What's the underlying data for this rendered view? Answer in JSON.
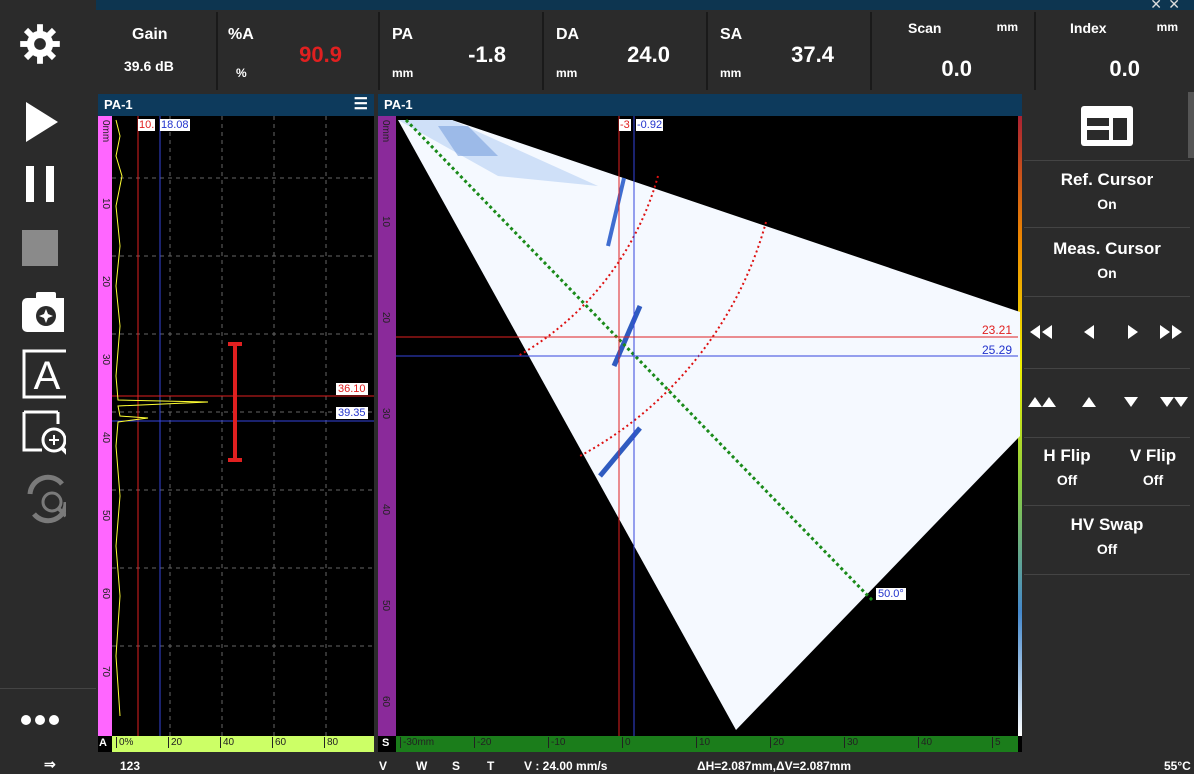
{
  "toolbar": {
    "icons": [
      "gear-icon",
      "play-icon",
      "pause-icon",
      "stop-icon",
      "camera-icon",
      "text-annotation-icon",
      "zoom-icon",
      "refresh-zoom-icon",
      "more-icon"
    ]
  },
  "readouts": {
    "gain": {
      "label": "Gain",
      "value": "39.6 dB"
    },
    "pa_a": {
      "label": "%A",
      "unit": "%",
      "value": "90.9",
      "color": "#e02020"
    },
    "pa": {
      "label": "PA",
      "unit": "mm",
      "value": "-1.8"
    },
    "da": {
      "label": "DA",
      "unit": "mm",
      "value": "24.0"
    },
    "sa": {
      "label": "SA",
      "unit": "mm",
      "value": "37.4"
    },
    "scan": {
      "label": "Scan",
      "unit": "mm",
      "value": "0.0"
    },
    "index": {
      "label": "Index",
      "unit": "mm",
      "value": "0.0"
    }
  },
  "ascan": {
    "title": "PA-1",
    "cursor_red": "10.",
    "cursor_blue": "18.08",
    "gate_red": "36.10",
    "gate_blue": "39.35",
    "y_ticks": [
      "0mm",
      "10",
      "20",
      "30",
      "40",
      "50",
      "60",
      "70"
    ],
    "x_ticks": [
      "0%",
      "20",
      "40",
      "60",
      "80"
    ],
    "corner_label": "A"
  },
  "sscan": {
    "title": "PA-1",
    "cursor_red": "-3",
    "cursor_blue": "-0.92",
    "h_red": "23.21",
    "h_blue": "25.29",
    "angle": "50.0°",
    "y_ticks": [
      "0mm",
      "10",
      "20",
      "30",
      "40",
      "50",
      "60"
    ],
    "x_ticks": [
      "-30mm",
      "-20",
      "-10",
      "0",
      "10",
      "20",
      "30",
      "40",
      "5"
    ],
    "corner_label": "S"
  },
  "right_menu": {
    "ref_cursor": {
      "label": "Ref. Cursor",
      "state": "On"
    },
    "meas_cursor": {
      "label": "Meas. Cursor",
      "state": "On"
    },
    "h_flip": {
      "label": "H Flip",
      "state": "Off"
    },
    "v_flip": {
      "label": "V Flip",
      "state": "Off"
    },
    "hv_swap": {
      "label": "HV Swap",
      "state": "Off"
    }
  },
  "status": {
    "count": "123",
    "v": "V",
    "w": "W",
    "s": "S",
    "t": "T",
    "velocity": "V : 24.00 mm/s",
    "delta": "ΔH=2.087mm,ΔV=2.087mm",
    "temp": "55°C"
  },
  "colors": {
    "accent": "#0d3a5c",
    "magenta": "#ff66ff",
    "lime": "#ccff66",
    "green": "#228b22",
    "red": "#e02020",
    "blue": "#2233cc"
  }
}
